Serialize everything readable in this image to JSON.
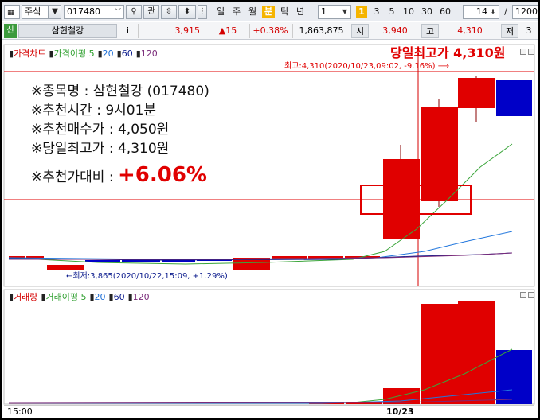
{
  "toolbar": {
    "market_type": "주식",
    "stock_code": "017480",
    "search_icon": "search-icon",
    "related_label": "관",
    "period_labels": [
      "일",
      "주",
      "월",
      "분",
      "틱",
      "년"
    ],
    "selected_period": "분",
    "interval_value": "1",
    "minute_buttons": [
      "1",
      "3",
      "5",
      "10",
      "30",
      "60"
    ],
    "selected_minute": "1",
    "count_value": "14",
    "slash": "/",
    "total_value": "1200"
  },
  "quote_bar": {
    "new_badge": "신",
    "stock_name": "삼현철강",
    "info_icon": "i",
    "price": "3,915",
    "change": "▲15",
    "change_pct": "+0.38%",
    "volume": "1,863,875",
    "open_label": "시",
    "open_value": "3,940",
    "high_label": "고",
    "high_value": "4,310",
    "low_label": "저",
    "low_value": "3"
  },
  "price_panel": {
    "legend": [
      {
        "label": "가격차트",
        "color": "#d40000"
      },
      {
        "label": "가격이평 5",
        "color": "#2a9d2a"
      },
      {
        "label": "20",
        "color": "#1e6fd6"
      },
      {
        "label": "60",
        "color": "#0a1a8c"
      },
      {
        "label": "120",
        "color": "#7a2b7a"
      }
    ],
    "daily_high_title": "당일최고가 4,310원",
    "high_annotation": "최고:4,310(2020/10/23,09:02, -9.16%)",
    "low_annotation": "←최저:3,865(2020/10/22,15:09, +1.29%)"
  },
  "overlay": {
    "line1": "※종목명 : 삼현철강 (017480)",
    "line2": "※추천시간 : 9시01분",
    "line3": "※추천매수가 : 4,050원",
    "line4": "※당일최고가 : 4,310원",
    "line5_label": "※추천가대비 : ",
    "line5_value": "+6.06%"
  },
  "volume_panel": {
    "legend": [
      {
        "label": "거래량",
        "color": "#d40000"
      },
      {
        "label": "거래이평 5",
        "color": "#2a9d2a"
      },
      {
        "label": "20",
        "color": "#1e6fd6"
      },
      {
        "label": "60",
        "color": "#0a1a8c"
      },
      {
        "label": "120",
        "color": "#7a2b7a"
      }
    ]
  },
  "time_axis": {
    "left_label": "15:00",
    "date_label": "10/23"
  },
  "colors": {
    "up": "#e00000",
    "down": "#0000c8",
    "highlight": "#e00000"
  }
}
